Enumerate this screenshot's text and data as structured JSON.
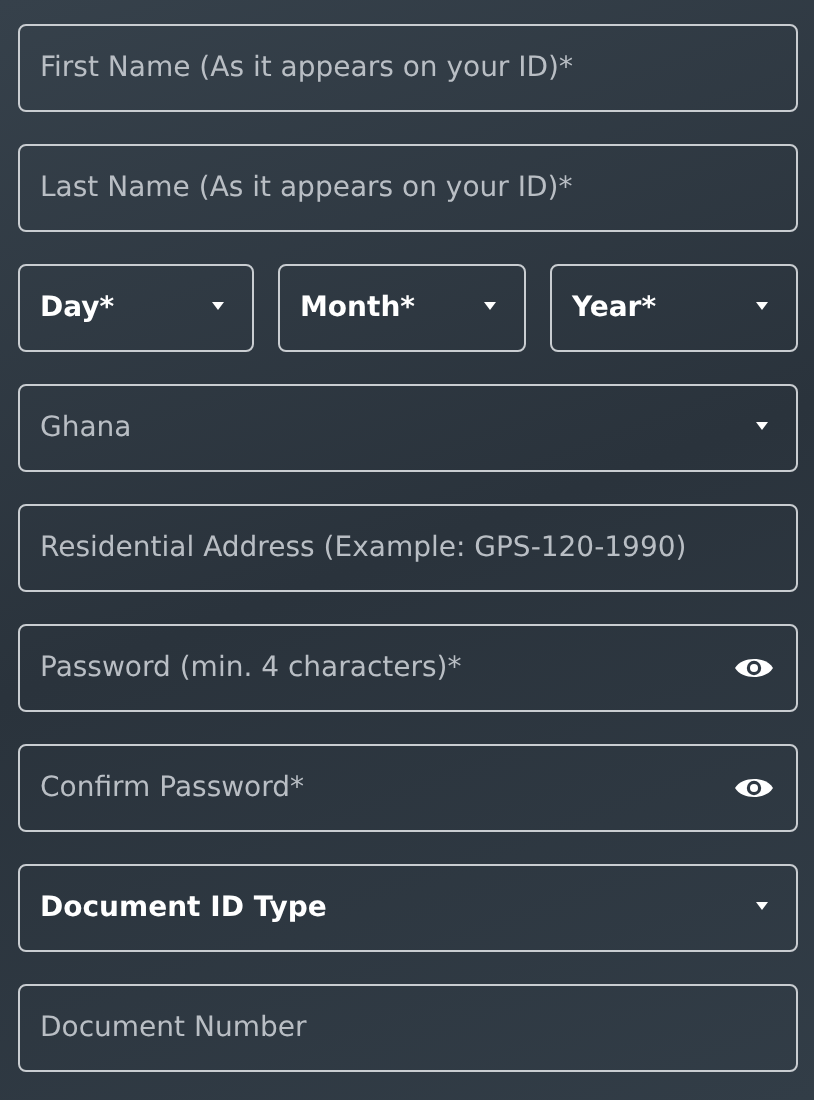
{
  "fields": [
    {
      "kind": "text",
      "placeholder": "First Name (As it appears on your ID)*"
    },
    {
      "kind": "text",
      "placeholder": "Last Name (As it appears on your ID)*"
    },
    {
      "kind": "row",
      "parts": [
        {
          "kind": "select",
          "label": "Day*",
          "muted": false
        },
        {
          "kind": "select",
          "label": "Month*",
          "muted": false
        },
        {
          "kind": "select",
          "label": "Year*",
          "muted": false
        }
      ]
    },
    {
      "kind": "select",
      "label": "Ghana",
      "muted": true
    },
    {
      "kind": "text",
      "placeholder": "Residential Address (Example: GPS-120-1990)"
    },
    {
      "kind": "password",
      "placeholder": "Password (min. 4 characters)*"
    },
    {
      "kind": "password",
      "placeholder": "Confirm Password*"
    },
    {
      "kind": "select",
      "label": "Document ID Type",
      "muted": false
    },
    {
      "kind": "text",
      "placeholder": "Document Number"
    }
  ]
}
